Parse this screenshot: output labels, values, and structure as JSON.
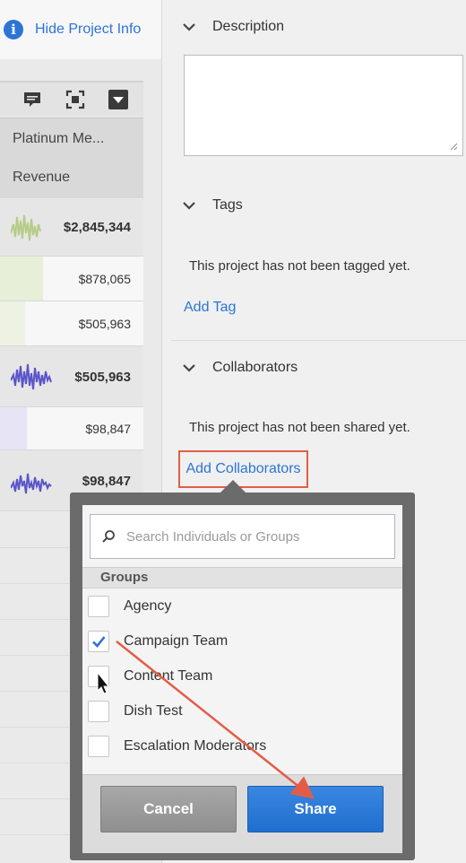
{
  "left_panel": {
    "hide_info_label": "Hide Project Info",
    "table": {
      "header_metric": "Platinum Me...",
      "header_submetric": "Revenue",
      "rows": [
        {
          "value": "$2,845,344",
          "bold": true,
          "sparkline": true
        },
        {
          "value": "$878,065",
          "bold": false,
          "sparkline": false
        },
        {
          "value": "$505,963",
          "bold": false,
          "sparkline": false
        },
        {
          "value": "$505,963",
          "bold": true,
          "sparkline": true
        },
        {
          "value": "$98,847",
          "bold": false,
          "sparkline": false
        },
        {
          "value": "$98,847",
          "bold": true,
          "sparkline": true
        }
      ]
    }
  },
  "right_panel": {
    "description": {
      "title": "Description",
      "value": ""
    },
    "tags": {
      "title": "Tags",
      "empty_message": "This project has not been tagged yet.",
      "add_label": "Add Tag"
    },
    "collaborators": {
      "title": "Collaborators",
      "empty_message": "This project has not been shared yet.",
      "add_label": "Add Collaborators"
    }
  },
  "popover": {
    "search_placeholder": "Search Individuals or Groups",
    "groups_header": "Groups",
    "groups": [
      {
        "label": "Agency",
        "checked": false
      },
      {
        "label": "Campaign Team",
        "checked": true
      },
      {
        "label": "Content Team",
        "checked": false
      },
      {
        "label": "Dish Test",
        "checked": false
      },
      {
        "label": "Escalation Moderators",
        "checked": false
      }
    ],
    "cancel_label": "Cancel",
    "share_label": "Share"
  },
  "colors": {
    "link": "#2d74d5",
    "primary_button": "#2a7bd8",
    "highlight_annotation": "#e25d48",
    "sparkline_green": "#b5cc86",
    "sparkline_purple": "#5b55c9"
  }
}
